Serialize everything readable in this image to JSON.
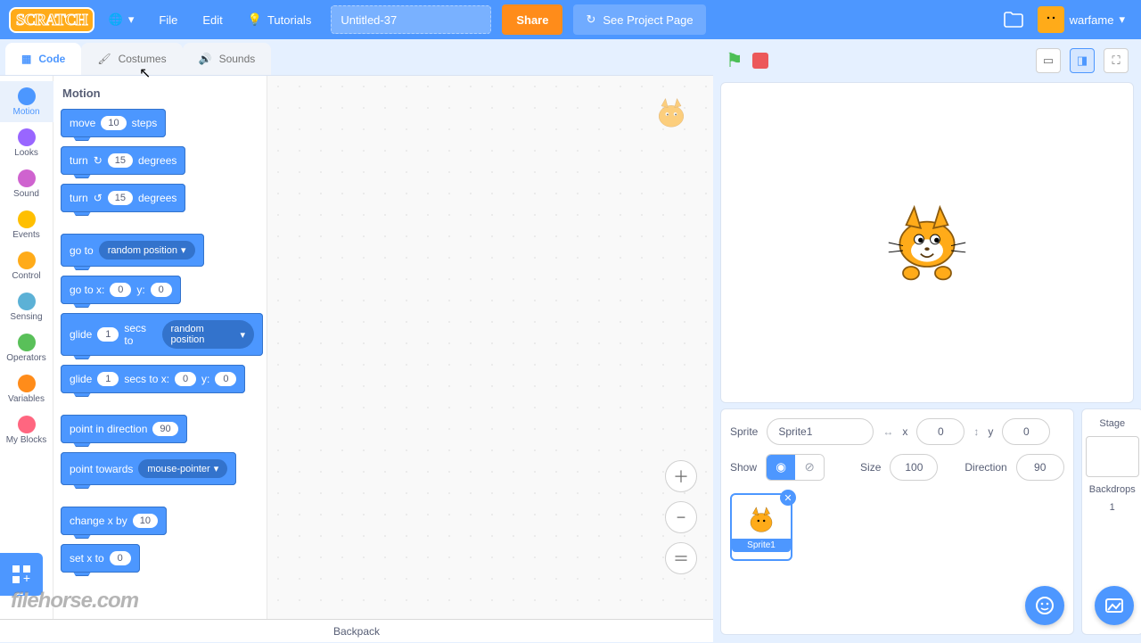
{
  "menubar": {
    "file": "File",
    "edit": "Edit",
    "tutorials": "Tutorials",
    "project_title": "Untitled-37",
    "share": "Share",
    "see_project": "See Project Page",
    "username": "warfame"
  },
  "tabs": {
    "code": "Code",
    "costumes": "Costumes",
    "sounds": "Sounds"
  },
  "categories": [
    {
      "name": "Motion",
      "color": "#4c97ff"
    },
    {
      "name": "Looks",
      "color": "#9966ff"
    },
    {
      "name": "Sound",
      "color": "#cf63cf"
    },
    {
      "name": "Events",
      "color": "#ffbf00"
    },
    {
      "name": "Control",
      "color": "#ffab19"
    },
    {
      "name": "Sensing",
      "color": "#5cb1d6"
    },
    {
      "name": "Operators",
      "color": "#59c059"
    },
    {
      "name": "Variables",
      "color": "#ff8c1a"
    },
    {
      "name": "My Blocks",
      "color": "#ff6680"
    }
  ],
  "palette": {
    "heading": "Motion",
    "blocks": {
      "move": {
        "pre": "move",
        "val": "10",
        "post": "steps"
      },
      "turn_cw": {
        "pre": "turn",
        "icon": "↻",
        "val": "15",
        "post": "degrees"
      },
      "turn_ccw": {
        "pre": "turn",
        "icon": "↺",
        "val": "15",
        "post": "degrees"
      },
      "goto": {
        "pre": "go to",
        "drop": "random position"
      },
      "gotoxy": {
        "pre": "go to x:",
        "x": "0",
        "mid": "y:",
        "y": "0"
      },
      "glide": {
        "pre": "glide",
        "secs": "1",
        "mid": "secs to",
        "drop": "random position"
      },
      "glidexy": {
        "pre": "glide",
        "secs": "1",
        "mid": "secs to x:",
        "x": "0",
        "mid2": "y:",
        "y": "0"
      },
      "point_dir": {
        "pre": "point in direction",
        "val": "90"
      },
      "point_towards": {
        "pre": "point towards",
        "drop": "mouse-pointer"
      },
      "changex": {
        "pre": "change x by",
        "val": "10"
      },
      "setx": {
        "pre": "set x to",
        "val": "0"
      }
    }
  },
  "backpack": "Backpack",
  "sprite_info": {
    "sprite_label": "Sprite",
    "sprite_name": "Sprite1",
    "x_label": "x",
    "x": "0",
    "y_label": "y",
    "y": "0",
    "show_label": "Show",
    "size_label": "Size",
    "size": "100",
    "dir_label": "Direction",
    "dir": "90"
  },
  "stage_col": {
    "title": "Stage",
    "backdrops_label": "Backdrops",
    "backdrops_count": "1"
  },
  "sprite_card": "Sprite1",
  "watermark": "filehorse.com"
}
